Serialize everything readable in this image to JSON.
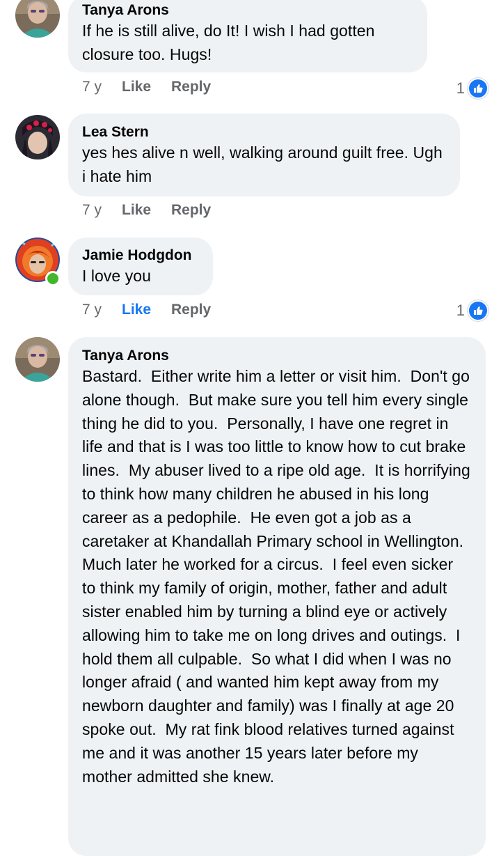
{
  "comments": [
    {
      "author": "Tanya Arons",
      "text": "If he is still alive, do It!  I wish I had gotten closure too.  Hugs!",
      "time": "7 y",
      "like_label": "Like",
      "reply_label": "Reply",
      "reaction_count": "1",
      "reaction_icon": "thumbs-up-icon"
    },
    {
      "author": "Lea Stern",
      "text": "yes hes alive n well, walking around guilt free. Ugh i hate him",
      "time": "7 y",
      "like_label": "Like",
      "reply_label": "Reply"
    },
    {
      "author": "Jamie Hodgdon",
      "text": "I love you",
      "time": "7 y",
      "like_label": "Like",
      "liked": true,
      "reply_label": "Reply",
      "reaction_count": "1",
      "reaction_icon": "thumbs-up-icon",
      "online": true
    },
    {
      "author": "Tanya Arons",
      "text": "Bastard.  Either write him a letter or visit him.  Don't go alone though.  But make sure you tell him every single thing he did to you.  Personally, I have one regret in life and that is I was too little to know how to cut brake lines.  My abuser lived to a ripe old age.  It is horrifying to think how many children he abused in his long career as a pedophile.  He even got a job as a caretaker at Khandallah Primary school in Wellington.  Much later he worked for a circus.  I feel even sicker to think my family of origin, mother, father and adult sister enabled him by turning a blind eye or actively allowing him to take me on long drives and outings.  I hold them all culpable.  So what I did when I was no longer afraid ( and wanted him kept away from my newborn daughter and family) was I finally at age 20 spoke out.  My rat fink blood relatives turned against me and it was another 15 years later before my mother admitted she knew."
    }
  ],
  "colors": {
    "bubble": "#eff2f5",
    "meta": "#65676b",
    "like_active": "#1877f2",
    "online": "#42b72a"
  }
}
